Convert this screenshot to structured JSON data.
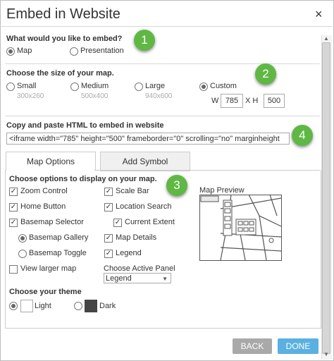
{
  "dialog": {
    "title": "Embed in Website",
    "close_glyph": "×"
  },
  "embed": {
    "question": "What would you like to embed?",
    "options": [
      {
        "label": "Map",
        "selected": true
      },
      {
        "label": "Presentation",
        "selected": false
      }
    ]
  },
  "size": {
    "question": "Choose the size of your map.",
    "options": [
      {
        "label": "Small",
        "dims": "300x260",
        "selected": false
      },
      {
        "label": "Medium",
        "dims": "500x400",
        "selected": false
      },
      {
        "label": "Large",
        "dims": "940x600",
        "selected": false
      },
      {
        "label": "Custom",
        "dims": "",
        "selected": true
      }
    ],
    "width_label": "W",
    "width_value": "785",
    "height_label": "X H",
    "height_value": "500"
  },
  "html": {
    "label": "Copy and paste HTML to embed in website",
    "code": "<iframe width=\"785\" height=\"500\" frameborder=\"0\" scrolling=\"no\" marginheight"
  },
  "tabs": [
    {
      "label": "Map Options",
      "active": true
    },
    {
      "label": "Add Symbol",
      "active": false
    }
  ],
  "options": {
    "question": "Choose options to display on your map.",
    "zoom_control": "Zoom Control",
    "home_button": "Home Button",
    "basemap_selector": "Basemap Selector",
    "basemap_gallery": "Basemap Gallery",
    "basemap_toggle": "Basemap Toggle",
    "view_larger": "View larger map",
    "scale_bar": "Scale Bar",
    "location_search": "Location Search",
    "current_extent": "Current Extent",
    "map_details": "Map Details",
    "legend": "Legend",
    "active_panel_label": "Choose Active Panel",
    "active_panel_value": "Legend",
    "preview_label": "Map Preview"
  },
  "theme": {
    "question": "Choose your theme",
    "light": "Light",
    "dark": "Dark",
    "light_color": "#ffffff",
    "dark_color": "#444444"
  },
  "buttons": {
    "back": "BACK",
    "done": "DONE",
    "back_color": "#a9a9a9",
    "done_color": "#5ab0e0"
  },
  "badges": [
    "1",
    "2",
    "3",
    "4"
  ],
  "accent": "#5fb844"
}
